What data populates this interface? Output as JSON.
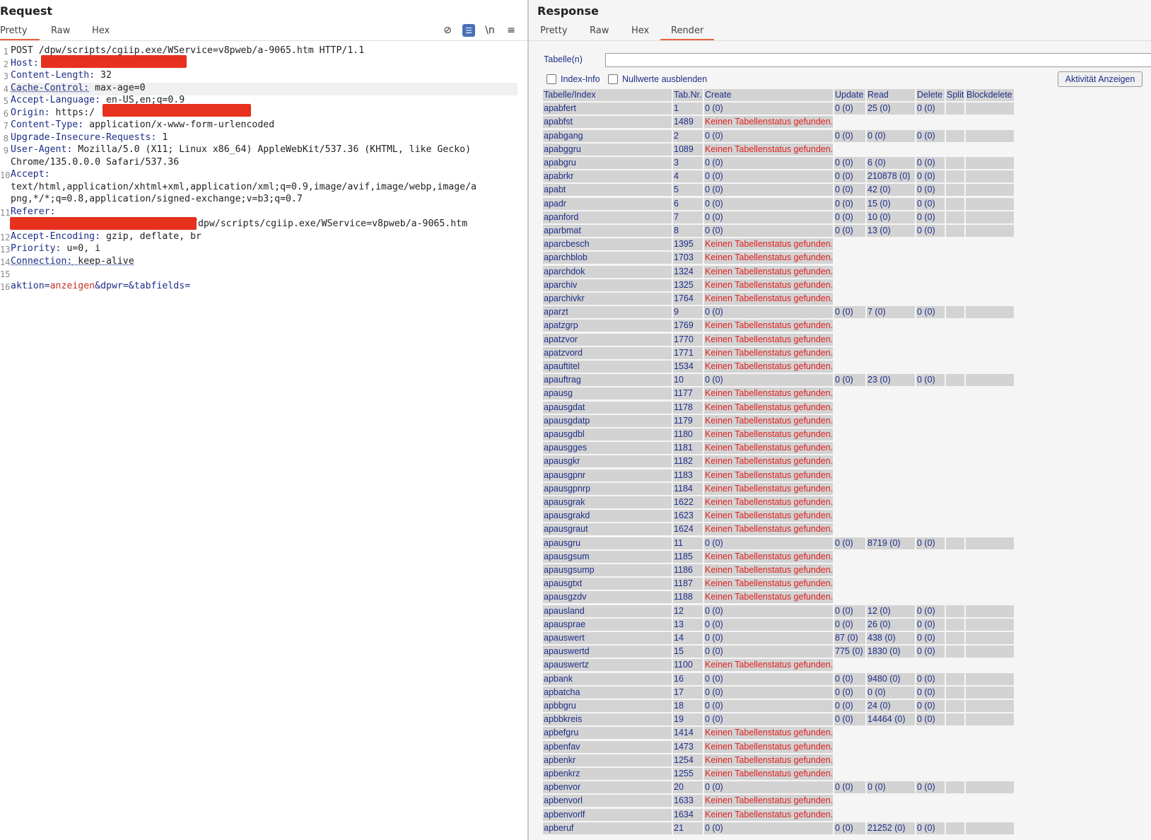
{
  "request": {
    "title": "Request",
    "tabs": [
      "Pretty",
      "Raw",
      "Hex"
    ],
    "icons": [
      "eye-off-icon",
      "wrap-icon",
      "newline-icon",
      "menu-icon"
    ],
    "icon_glyphs": [
      "⊘",
      "☰",
      "\\n",
      "≡"
    ],
    "lines": [
      {
        "n": "1",
        "k": "",
        "v": "POST /dpw/scripts/cgiip.exe/WService=v8pweb/a-9065.htm HTTP/1.1"
      },
      {
        "n": "2",
        "k": "Host:",
        "v": ""
      },
      {
        "n": "3",
        "k": "Content-Length:",
        "v": " 32"
      },
      {
        "n": "4",
        "k": "Cache-Control:",
        "v": " max-age=0"
      },
      {
        "n": "5",
        "k": "Accept-Language:",
        "v": " en-US,en;q=0.9"
      },
      {
        "n": "6",
        "k": "Origin:",
        "v": " https:/"
      },
      {
        "n": "7",
        "k": "Content-Type:",
        "v": " application/x-www-form-urlencoded"
      },
      {
        "n": "8",
        "k": "Upgrade-Insecure-Requests:",
        "v": " 1"
      },
      {
        "n": "9",
        "k": "User-Agent:",
        "v": " Mozilla/5.0 (X11; Linux x86_64) AppleWebKit/537.36 (KHTML, like Gecko)"
      },
      {
        "n": "",
        "k": "",
        "v": "Chrome/135.0.0.0 Safari/537.36"
      },
      {
        "n": "10",
        "k": "Accept:",
        "v": ""
      },
      {
        "n": "",
        "k": "",
        "v": "text/html,application/xhtml+xml,application/xml;q=0.9,image/avif,image/webp,image/a"
      },
      {
        "n": "",
        "k": "",
        "v": "png,*/*;q=0.8,application/signed-exchange;v=b3;q=0.7"
      },
      {
        "n": "11",
        "k": "Referer:",
        "v": ""
      },
      {
        "n": "",
        "k": "",
        "v": "/dpw/scripts/cgiip.exe/WService=v8pweb/a-9065.htm"
      },
      {
        "n": "12",
        "k": "Accept-Encoding:",
        "v": " gzip, deflate, br"
      },
      {
        "n": "13",
        "k": "Priority:",
        "v": " u=0, i"
      },
      {
        "n": "14",
        "k": "Connection:",
        "v": " keep-alive"
      },
      {
        "n": "15",
        "k": "",
        "v": ""
      }
    ],
    "body_params": [
      {
        "key": "aktion",
        "sep": "=",
        "value": "anzeigen"
      },
      {
        "key": "&dpwr",
        "sep": "=",
        "value": ""
      },
      {
        "key": "&tabfields",
        "sep": "=",
        "value": ""
      }
    ],
    "body_line_num": "16"
  },
  "response": {
    "title": "Response",
    "tabs": [
      "Pretty",
      "Raw",
      "Hex",
      "Render"
    ],
    "active_tab": "Render",
    "table_label": "Tabelle(n)",
    "checkbox_index": "Index-Info",
    "checkbox_null": "Nullwerte ausblenden",
    "button_label": "Aktivität Anzeigen",
    "headers": [
      "Tabelle/Index",
      "Tab.Nr.",
      "Create",
      "Update",
      "Read",
      "Delete",
      "Split",
      "Blockdelete"
    ],
    "error_text": "Keinen Tabellenstatus gefunden.",
    "rows": [
      [
        "apabfert",
        "1",
        "0 (0)",
        "0 (0)",
        "25 (0)",
        "0 (0)"
      ],
      [
        "apabfst",
        "1489"
      ],
      [
        "apabgang",
        "2",
        "0 (0)",
        "0 (0)",
        "0 (0)",
        "0 (0)"
      ],
      [
        "apabggru",
        "1089"
      ],
      [
        "apabgru",
        "3",
        "0 (0)",
        "0 (0)",
        "6 (0)",
        "0 (0)"
      ],
      [
        "apabrkr",
        "4",
        "0 (0)",
        "0 (0)",
        "210878 (0)",
        "0 (0)"
      ],
      [
        "apabt",
        "5",
        "0 (0)",
        "0 (0)",
        "42 (0)",
        "0 (0)"
      ],
      [
        "apadr",
        "6",
        "0 (0)",
        "0 (0)",
        "15 (0)",
        "0 (0)"
      ],
      [
        "apanford",
        "7",
        "0 (0)",
        "0 (0)",
        "10 (0)",
        "0 (0)"
      ],
      [
        "aparbmat",
        "8",
        "0 (0)",
        "0 (0)",
        "13 (0)",
        "0 (0)"
      ],
      [
        "aparcbesch",
        "1395"
      ],
      [
        "aparchblob",
        "1703"
      ],
      [
        "aparchdok",
        "1324"
      ],
      [
        "aparchiv",
        "1325"
      ],
      [
        "aparchivkr",
        "1764"
      ],
      [
        "aparzt",
        "9",
        "0 (0)",
        "0 (0)",
        "7 (0)",
        "0 (0)"
      ],
      [
        "apatzgrp",
        "1769"
      ],
      [
        "apatzvor",
        "1770"
      ],
      [
        "apatzvord",
        "1771"
      ],
      [
        "apauftitel",
        "1534"
      ],
      [
        "apauftrag",
        "10",
        "0 (0)",
        "0 (0)",
        "23 (0)",
        "0 (0)"
      ],
      [
        "apausg",
        "1177"
      ],
      [
        "apausgdat",
        "1178"
      ],
      [
        "apausgdatp",
        "1179"
      ],
      [
        "apausgdbl",
        "1180"
      ],
      [
        "apausgges",
        "1181"
      ],
      [
        "apausgkr",
        "1182"
      ],
      [
        "apausgpnr",
        "1183"
      ],
      [
        "apausgpnrp",
        "1184"
      ],
      [
        "apausgrak",
        "1622"
      ],
      [
        "apausgrakd",
        "1623"
      ],
      [
        "apausgraut",
        "1624"
      ],
      [
        "apausgru",
        "11",
        "0 (0)",
        "0 (0)",
        "8719 (0)",
        "0 (0)"
      ],
      [
        "apausgsum",
        "1185"
      ],
      [
        "apausgsump",
        "1186"
      ],
      [
        "apausgtxt",
        "1187"
      ],
      [
        "apausgzdv",
        "1188"
      ],
      [
        "apausland",
        "12",
        "0 (0)",
        "0 (0)",
        "12 (0)",
        "0 (0)"
      ],
      [
        "apausprae",
        "13",
        "0 (0)",
        "0 (0)",
        "26 (0)",
        "0 (0)"
      ],
      [
        "apauswert",
        "14",
        "0 (0)",
        "87 (0)",
        "438 (0)",
        "0 (0)"
      ],
      [
        "apauswertd",
        "15",
        "0 (0)",
        "775 (0)",
        "1830 (0)",
        "0 (0)"
      ],
      [
        "apauswertz",
        "1100"
      ],
      [
        "apbank",
        "16",
        "0 (0)",
        "0 (0)",
        "9480 (0)",
        "0 (0)"
      ],
      [
        "apbatcha",
        "17",
        "0 (0)",
        "0 (0)",
        "0 (0)",
        "0 (0)"
      ],
      [
        "apbbgru",
        "18",
        "0 (0)",
        "0 (0)",
        "24 (0)",
        "0 (0)"
      ],
      [
        "apbbkreis",
        "19",
        "0 (0)",
        "0 (0)",
        "14464 (0)",
        "0 (0)"
      ],
      [
        "apbefgru",
        "1414"
      ],
      [
        "apbenfav",
        "1473"
      ],
      [
        "apbenkr",
        "1254"
      ],
      [
        "apbenkrz",
        "1255"
      ],
      [
        "apbenvor",
        "20",
        "0 (0)",
        "0 (0)",
        "0 (0)",
        "0 (0)"
      ],
      [
        "apbenvorl",
        "1633"
      ],
      [
        "apbenvorlf",
        "1634"
      ],
      [
        "apberuf",
        "21",
        "0 (0)",
        "0 (0)",
        "21252 (0)",
        "0 (0)"
      ]
    ]
  }
}
